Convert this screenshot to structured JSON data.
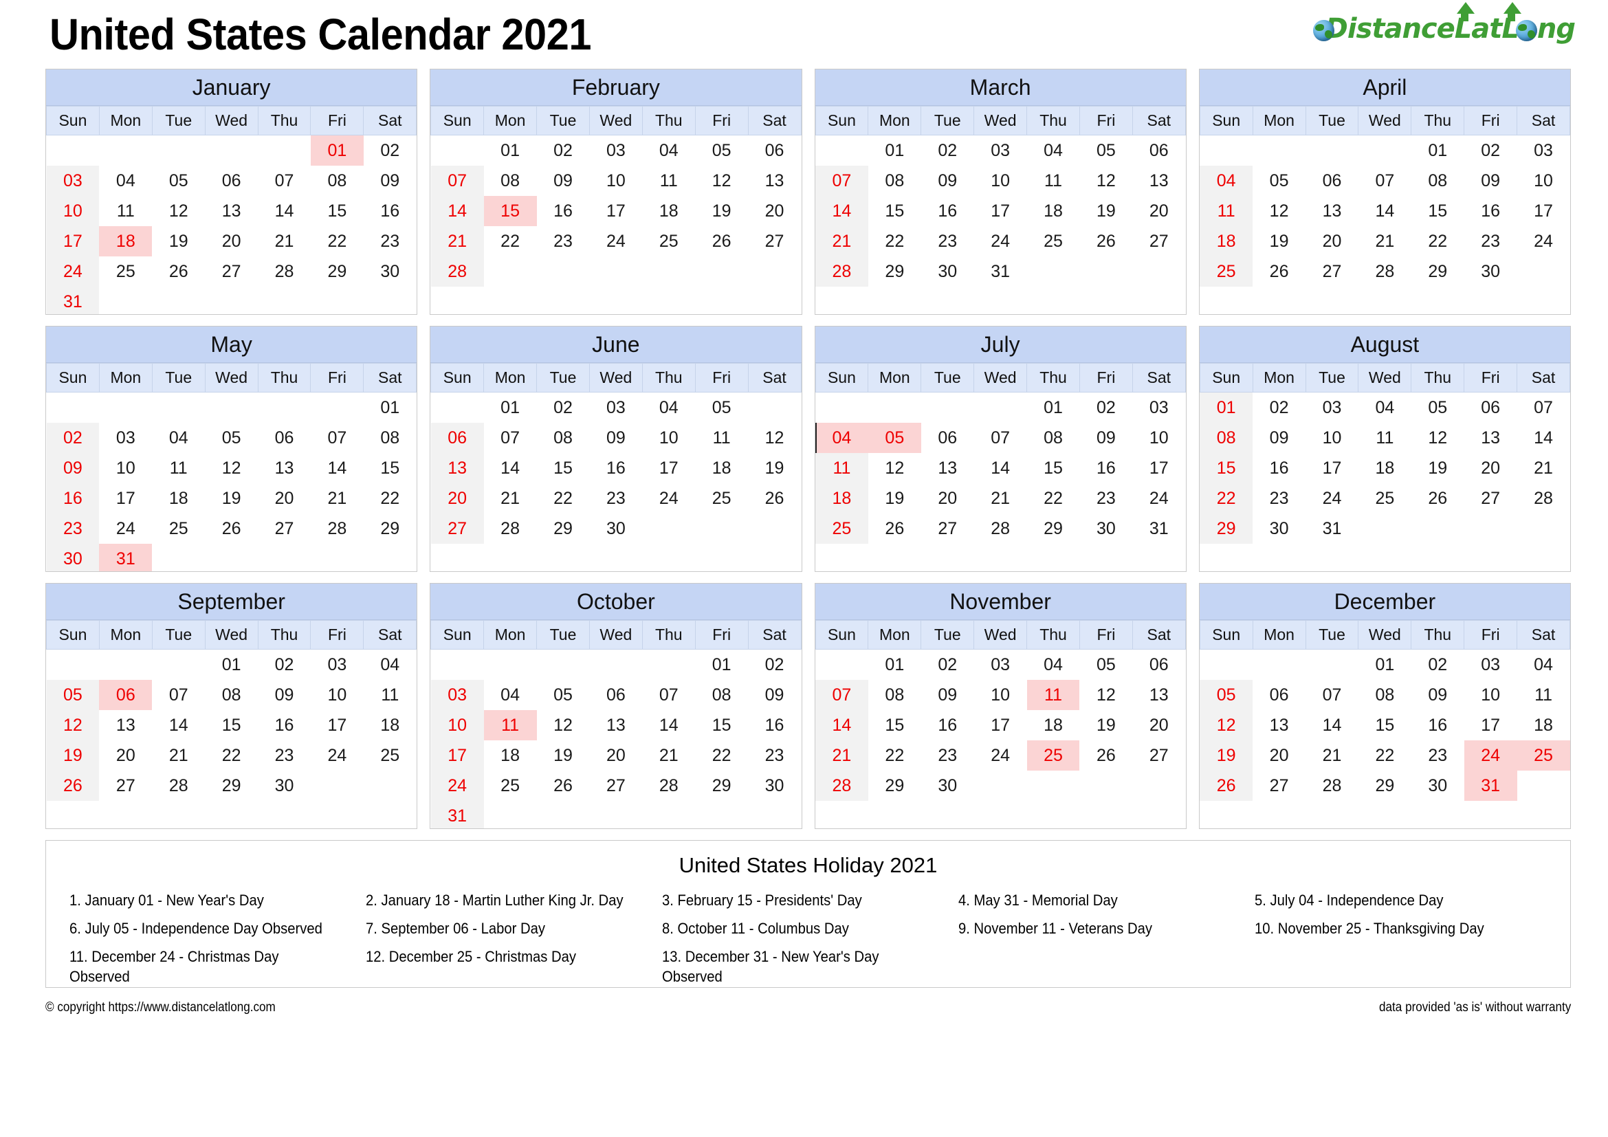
{
  "header": {
    "title": "United States Calendar 2021",
    "logo": {
      "text_part1": "D",
      "text_part2": "istance",
      "text_part3": "L",
      "text_part4": "at",
      "text_part5": "L",
      "text_part6": "o",
      "text_part7": "ng",
      "full_text": "DistanceLatLong",
      "color": "#3f9e35"
    }
  },
  "colors": {
    "month_header_bg": "#c5d5f4",
    "weekday_header_bg": "#dde7f9",
    "sunday_bg": "#f2f2f2",
    "sunday_text": "#ee0000",
    "holiday_bg": "#fbd4d4",
    "holiday_text": "#ee0000",
    "card_border": "#c9c9c9"
  },
  "weekdays": [
    "Sun",
    "Mon",
    "Tue",
    "Wed",
    "Thu",
    "Fri",
    "Sat"
  ],
  "months": [
    {
      "name": "January",
      "weeks": [
        [
          "",
          "",
          "",
          "",
          "",
          "01",
          "02"
        ],
        [
          "03",
          "04",
          "05",
          "06",
          "07",
          "08",
          "09"
        ],
        [
          "10",
          "11",
          "12",
          "13",
          "14",
          "15",
          "16"
        ],
        [
          "17",
          "18",
          "19",
          "20",
          "21",
          "22",
          "23"
        ],
        [
          "24",
          "25",
          "26",
          "27",
          "28",
          "29",
          "30"
        ],
        [
          "31",
          "",
          "",
          "",
          "",
          "",
          ""
        ]
      ],
      "holidays": [
        "01",
        "18"
      ]
    },
    {
      "name": "February",
      "weeks": [
        [
          "",
          "01",
          "02",
          "03",
          "04",
          "05",
          "06"
        ],
        [
          "07",
          "08",
          "09",
          "10",
          "11",
          "12",
          "13"
        ],
        [
          "14",
          "15",
          "16",
          "17",
          "18",
          "19",
          "20"
        ],
        [
          "21",
          "22",
          "23",
          "24",
          "25",
          "26",
          "27"
        ],
        [
          "28",
          "",
          "",
          "",
          "",
          "",
          ""
        ],
        [
          "",
          "",
          "",
          "",
          "",
          "",
          ""
        ]
      ],
      "holidays": [
        "15"
      ]
    },
    {
      "name": "March",
      "weeks": [
        [
          "",
          "01",
          "02",
          "03",
          "04",
          "05",
          "06"
        ],
        [
          "07",
          "08",
          "09",
          "10",
          "11",
          "12",
          "13"
        ],
        [
          "14",
          "15",
          "16",
          "17",
          "18",
          "19",
          "20"
        ],
        [
          "21",
          "22",
          "23",
          "24",
          "25",
          "26",
          "27"
        ],
        [
          "28",
          "29",
          "30",
          "31",
          "",
          "",
          ""
        ],
        [
          "",
          "",
          "",
          "",
          "",
          "",
          ""
        ]
      ],
      "holidays": []
    },
    {
      "name": "April",
      "weeks": [
        [
          "",
          "",
          "",
          "",
          "01",
          "02",
          "03"
        ],
        [
          "04",
          "05",
          "06",
          "07",
          "08",
          "09",
          "10"
        ],
        [
          "11",
          "12",
          "13",
          "14",
          "15",
          "16",
          "17"
        ],
        [
          "18",
          "19",
          "20",
          "21",
          "22",
          "23",
          "24"
        ],
        [
          "25",
          "26",
          "27",
          "28",
          "29",
          "30",
          ""
        ],
        [
          "",
          "",
          "",
          "",
          "",
          "",
          ""
        ]
      ],
      "holidays": []
    },
    {
      "name": "May",
      "weeks": [
        [
          "",
          "",
          "",
          "",
          "",
          "",
          "01"
        ],
        [
          "02",
          "03",
          "04",
          "05",
          "06",
          "07",
          "08"
        ],
        [
          "09",
          "10",
          "11",
          "12",
          "13",
          "14",
          "15"
        ],
        [
          "16",
          "17",
          "18",
          "19",
          "20",
          "21",
          "22"
        ],
        [
          "23",
          "24",
          "25",
          "26",
          "27",
          "28",
          "29"
        ],
        [
          "30",
          "31",
          "",
          "",
          "",
          "",
          ""
        ]
      ],
      "holidays": [
        "31"
      ]
    },
    {
      "name": "June",
      "weeks": [
        [
          "",
          "01",
          "02",
          "03",
          "04",
          "05",
          ""
        ],
        [
          "06",
          "07",
          "08",
          "09",
          "10",
          "11",
          "12"
        ],
        [
          "13",
          "14",
          "15",
          "16",
          "17",
          "18",
          "19"
        ],
        [
          "20",
          "21",
          "22",
          "23",
          "24",
          "25",
          "26"
        ],
        [
          "27",
          "28",
          "29",
          "30",
          "",
          "",
          ""
        ],
        [
          "",
          "",
          "",
          "",
          "",
          "",
          ""
        ]
      ],
      "holidays": []
    },
    {
      "name": "July",
      "weeks": [
        [
          "",
          "",
          "",
          "",
          "01",
          "02",
          "03"
        ],
        [
          "04",
          "05",
          "06",
          "07",
          "08",
          "09",
          "10"
        ],
        [
          "11",
          "12",
          "13",
          "14",
          "15",
          "16",
          "17"
        ],
        [
          "18",
          "19",
          "20",
          "21",
          "22",
          "23",
          "24"
        ],
        [
          "25",
          "26",
          "27",
          "28",
          "29",
          "30",
          "31"
        ],
        [
          "",
          "",
          "",
          "",
          "",
          "",
          ""
        ]
      ],
      "holidays": [
        "04",
        "05"
      ]
    },
    {
      "name": "August",
      "weeks": [
        [
          "01",
          "02",
          "03",
          "04",
          "05",
          "06",
          "07"
        ],
        [
          "08",
          "09",
          "10",
          "11",
          "12",
          "13",
          "14"
        ],
        [
          "15",
          "16",
          "17",
          "18",
          "19",
          "20",
          "21"
        ],
        [
          "22",
          "23",
          "24",
          "25",
          "26",
          "27",
          "28"
        ],
        [
          "29",
          "30",
          "31",
          "",
          "",
          "",
          ""
        ],
        [
          "",
          "",
          "",
          "",
          "",
          "",
          ""
        ]
      ],
      "holidays": []
    },
    {
      "name": "September",
      "weeks": [
        [
          "",
          "",
          "",
          "01",
          "02",
          "03",
          "04"
        ],
        [
          "05",
          "06",
          "07",
          "08",
          "09",
          "10",
          "11"
        ],
        [
          "12",
          "13",
          "14",
          "15",
          "16",
          "17",
          "18"
        ],
        [
          "19",
          "20",
          "21",
          "22",
          "23",
          "24",
          "25"
        ],
        [
          "26",
          "27",
          "28",
          "29",
          "30",
          "",
          ""
        ],
        [
          "",
          "",
          "",
          "",
          "",
          "",
          ""
        ]
      ],
      "holidays": [
        "06"
      ]
    },
    {
      "name": "October",
      "weeks": [
        [
          "",
          "",
          "",
          "",
          "",
          "01",
          "02"
        ],
        [
          "03",
          "04",
          "05",
          "06",
          "07",
          "08",
          "09"
        ],
        [
          "10",
          "11",
          "12",
          "13",
          "14",
          "15",
          "16"
        ],
        [
          "17",
          "18",
          "19",
          "20",
          "21",
          "22",
          "23"
        ],
        [
          "24",
          "25",
          "26",
          "27",
          "28",
          "29",
          "30"
        ],
        [
          "31",
          "",
          "",
          "",
          "",
          "",
          ""
        ]
      ],
      "holidays": [
        "11"
      ]
    },
    {
      "name": "November",
      "weeks": [
        [
          "",
          "01",
          "02",
          "03",
          "04",
          "05",
          "06"
        ],
        [
          "07",
          "08",
          "09",
          "10",
          "11",
          "12",
          "13"
        ],
        [
          "14",
          "15",
          "16",
          "17",
          "18",
          "19",
          "20"
        ],
        [
          "21",
          "22",
          "23",
          "24",
          "25",
          "26",
          "27"
        ],
        [
          "28",
          "29",
          "30",
          "",
          "",
          "",
          ""
        ],
        [
          "",
          "",
          "",
          "",
          "",
          "",
          ""
        ]
      ],
      "holidays": [
        "11",
        "25"
      ]
    },
    {
      "name": "December",
      "weeks": [
        [
          "",
          "",
          "",
          "01",
          "02",
          "03",
          "04"
        ],
        [
          "05",
          "06",
          "07",
          "08",
          "09",
          "10",
          "11"
        ],
        [
          "12",
          "13",
          "14",
          "15",
          "16",
          "17",
          "18"
        ],
        [
          "19",
          "20",
          "21",
          "22",
          "23",
          "24",
          "25"
        ],
        [
          "26",
          "27",
          "28",
          "29",
          "30",
          "31",
          ""
        ],
        [
          "",
          "",
          "",
          "",
          "",
          "",
          ""
        ]
      ],
      "holidays": [
        "24",
        "25",
        "31"
      ]
    }
  ],
  "holiday_section": {
    "heading": "United States Holiday 2021",
    "items": [
      "1. January 01 - New Year's Day",
      "2. January 18 - Martin Luther King Jr. Day",
      "3. February 15 - Presidents' Day",
      "4. May 31 - Memorial Day",
      "5. July 04 - Independence Day",
      "6. July 05 - Independence Day Observed",
      "7. September 06 - Labor Day",
      "8. October 11 - Columbus Day",
      "9. November 11 - Veterans Day",
      "10. November 25 - Thanksgiving Day",
      "11. December 24 - Christmas Day Observed",
      "12. December 25 - Christmas Day",
      "13. December 31 - New Year's Day Observed"
    ]
  },
  "footer": {
    "copyright": "© copyright https://www.distancelatlong.com",
    "disclaimer": "data provided 'as is' without warranty"
  }
}
